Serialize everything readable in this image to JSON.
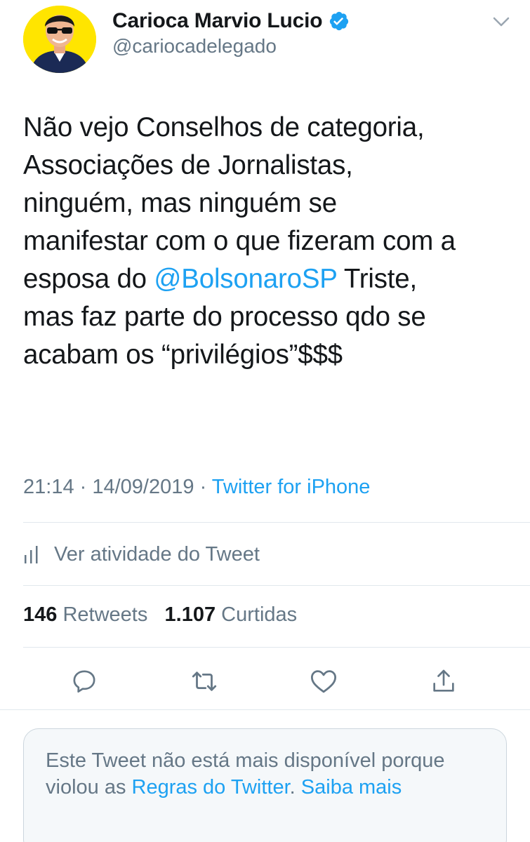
{
  "header": {
    "display_name": "Carioca Marvio Lucio",
    "handle": "@cariocadelegado",
    "verified": true,
    "avatar_bg": "#ffe500"
  },
  "tweet": {
    "text_line1": "Não vejo Conselhos de categoria,",
    "text_line2": "Associações de Jornalistas,",
    "text_line3": "ninguém, mas ninguém se",
    "text_line4": "manifestar com o que fizeram com a",
    "text_line5_pre": "esposa do ",
    "mention": "@BolsonaroSP",
    "text_line5_post": " Triste,",
    "text_line6": "mas faz parte do processo qdo se",
    "text_line7": "acabam os “privilégios”$$$"
  },
  "meta": {
    "time": "21:14",
    "separator": " · ",
    "date": "14/09/2019",
    "separator2": " · ",
    "source": "Twitter for iPhone"
  },
  "activity": {
    "label": "Ver atividade do Tweet",
    "icon": "analytics-icon"
  },
  "stats": {
    "retweets_count": "146",
    "retweets_label": "Retweets",
    "likes_count": "1.107",
    "likes_label": "Curtidas"
  },
  "actions": [
    {
      "icon": "reply-icon"
    },
    {
      "icon": "retweet-icon"
    },
    {
      "icon": "like-icon"
    },
    {
      "icon": "share-icon"
    }
  ],
  "notice": {
    "text_pre": "Este Tweet não está mais disponível porque violou as ",
    "rules_link": "Regras do Twitter",
    "text_mid": ". ",
    "more_link": "Saiba mais"
  },
  "colors": {
    "accent": "#1da1f2",
    "secondary_text": "#657786",
    "primary_text": "#14171a",
    "divider": "#e1e8ed"
  }
}
